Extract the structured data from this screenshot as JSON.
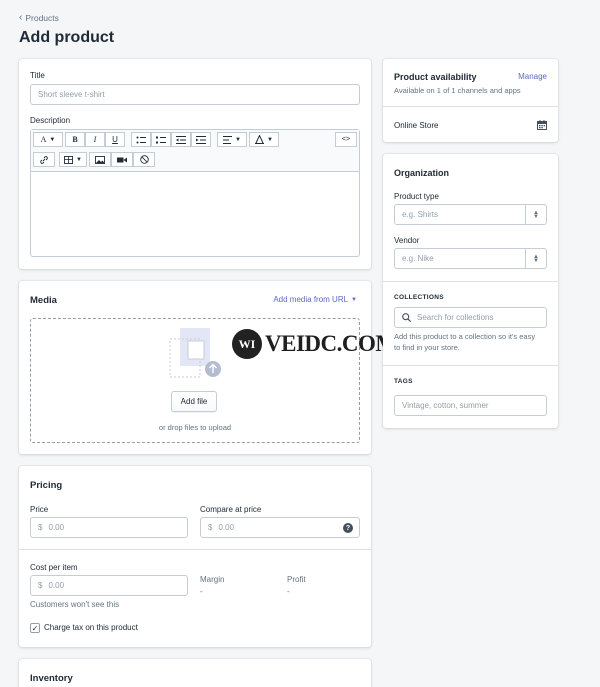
{
  "breadcrumb": {
    "label": "Products"
  },
  "page": {
    "title": "Add product"
  },
  "product": {
    "title_label": "Title",
    "title_placeholder": "Short sleeve t-shirt",
    "description_label": "Description"
  },
  "editor_toolbar": {
    "font": "A",
    "bold": "B",
    "italic": "I",
    "underline": "U",
    "html": "<>"
  },
  "media": {
    "heading": "Media",
    "add_from_url": "Add media from URL",
    "add_file": "Add file",
    "drop_hint": "or drop files to upload"
  },
  "pricing": {
    "heading": "Pricing",
    "price_label": "Price",
    "price_currency": "$",
    "price_value": "0.00",
    "compare_label": "Compare at price",
    "compare_currency": "$",
    "compare_value": "0.00",
    "cost_label": "Cost per item",
    "cost_currency": "$",
    "cost_value": "0.00",
    "cost_hint": "Customers won't see this",
    "margin_label": "Margin",
    "margin_value": "-",
    "profit_label": "Profit",
    "profit_value": "-",
    "charge_tax_label": "Charge tax on this product",
    "charge_tax_checked": true
  },
  "inventory": {
    "heading": "Inventory"
  },
  "availability": {
    "heading": "Product availability",
    "manage": "Manage",
    "summary": "Available on 1 of 1 channels and apps",
    "channel": "Online Store"
  },
  "organization": {
    "heading": "Organization",
    "product_type_label": "Product type",
    "product_type_placeholder": "e.g. Shirts",
    "vendor_label": "Vendor",
    "vendor_placeholder": "e.g. Nike",
    "collections_heading": "COLLECTIONS",
    "collections_placeholder": "Search for collections",
    "collections_hint_1": "Add this product to a collection so it's easy",
    "collections_hint_2": "to find in your store.",
    "tags_heading": "TAGS",
    "tags_placeholder": "Vintage, cotton, summer"
  },
  "watermark": {
    "text": "VEIDC.COM"
  },
  "colors": {
    "link": "#5c6ac4",
    "background": "#f4f6f8",
    "border": "#c4cdd5"
  }
}
